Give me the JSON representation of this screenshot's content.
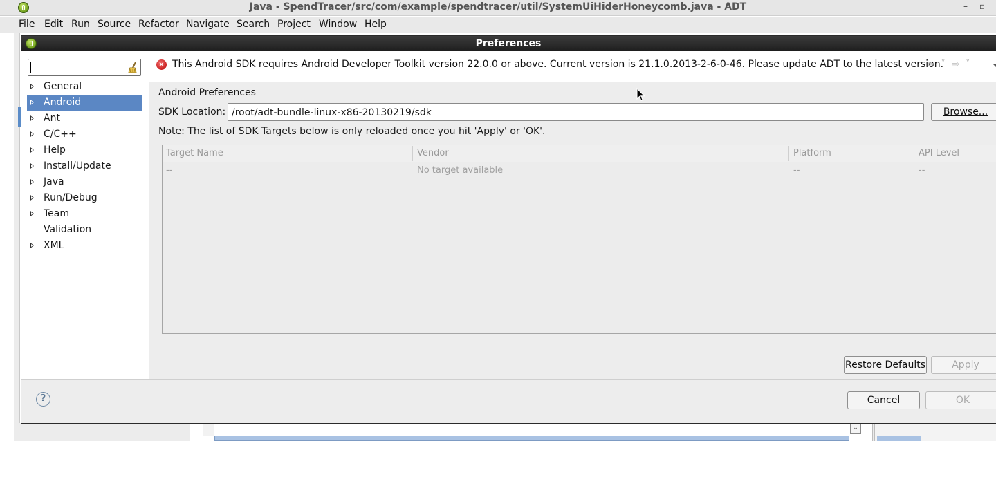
{
  "window": {
    "title": "Java - SpendTracer/src/com/example/spendtracer/util/SystemUiHiderHoneycomb.java - ADT",
    "minimize_glyph": "–",
    "maximize_glyph": "▫"
  },
  "menubar": {
    "items": [
      {
        "label": "File"
      },
      {
        "label": "Edit"
      },
      {
        "label": "Run"
      },
      {
        "label": "Source"
      },
      {
        "label": "Refactor"
      },
      {
        "label": "Navigate"
      },
      {
        "label": "Search"
      },
      {
        "label": "Project"
      },
      {
        "label": "Window"
      },
      {
        "label": "Help"
      }
    ]
  },
  "dialog": {
    "title": "Preferences",
    "filter": {
      "value": "",
      "placeholder": ""
    },
    "tree": [
      {
        "label": "General",
        "expandable": true
      },
      {
        "label": "Android",
        "expandable": true,
        "selected": true
      },
      {
        "label": "Ant",
        "expandable": true
      },
      {
        "label": "C/C++",
        "expandable": true
      },
      {
        "label": "Help",
        "expandable": true
      },
      {
        "label": "Install/Update",
        "expandable": true
      },
      {
        "label": "Java",
        "expandable": true
      },
      {
        "label": "Run/Debug",
        "expandable": true
      },
      {
        "label": "Team",
        "expandable": true
      },
      {
        "label": "Validation",
        "expandable": false
      },
      {
        "label": "XML",
        "expandable": true
      }
    ],
    "error_message": "This Android SDK requires Android Developer Toolkit version 22.0.0 or above.  Current version is 21.1.0.2013-2-6-0-46.  Please update ADT to the latest version.",
    "nav_glyphs": "⇦ ˅ ⇨ ˅",
    "page": {
      "section_title": "Android Preferences",
      "sdk_label": "SDK Location:",
      "sdk_value": "/root/adt-bundle-linux-x86-20130219/sdk",
      "browse_label": "Browse...",
      "note": "Note: The list of SDK Targets below is only reloaded once you hit 'Apply' or 'OK'.",
      "table": {
        "columns": [
          "Target Name",
          "Vendor",
          "Platform",
          "API Level"
        ],
        "rows": [
          [
            "--",
            "No target available",
            "--",
            "--"
          ]
        ]
      },
      "restore_defaults_label": "Restore Defaults",
      "apply_label": "Apply"
    },
    "footer": {
      "help_glyph": "?",
      "cancel_label": "Cancel",
      "ok_label": "OK"
    }
  },
  "colors": {
    "selection": "#5b87c4",
    "dialog_titlebar": "#2a2a2a",
    "error_icon": "#d22b2b",
    "disabled_text": "#a9a9a9"
  },
  "icons": [
    "app-icon",
    "broom-clear-icon",
    "error-icon",
    "help-icon",
    "back-arrow-icon",
    "forward-arrow-icon",
    "view-menu-icon",
    "mouse-cursor-icon"
  ]
}
